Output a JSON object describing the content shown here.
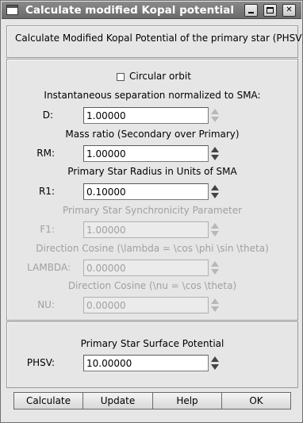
{
  "window": {
    "title": "Calculate modified Kopal potential"
  },
  "header": {
    "description": "Calculate Modified Kopal Potential of the primary star (PHSV):"
  },
  "circular_orbit": {
    "label": "Circular orbit",
    "checked": false
  },
  "fields": {
    "d": {
      "section": "Instantaneous separation normalized to SMA:",
      "label": "D:",
      "value": "1.00000",
      "enabled": true
    },
    "rm": {
      "section": "Mass ratio (Secondary over Primary)",
      "label": "RM:",
      "value": "1.00000",
      "enabled": true
    },
    "r1": {
      "section": "Primary Star Radius in Units of SMA",
      "label": "R1:",
      "value": "0.10000",
      "enabled": true
    },
    "f1": {
      "section": "Primary Star Synchronicity Parameter",
      "label": "F1:",
      "value": "1.00000",
      "enabled": false
    },
    "lambda": {
      "section": "Direction Cosine (\\lambda = \\cos \\phi \\sin \\theta)",
      "label": "LAMBDA:",
      "value": "0.00000",
      "enabled": false
    },
    "nu": {
      "section": "Direction Cosine (\\nu = \\cos \\theta)",
      "label": "NU:",
      "value": "0.00000",
      "enabled": false
    }
  },
  "result": {
    "section": "Primary Star Surface Potential",
    "label": "PHSV:",
    "value": "10.00000"
  },
  "buttons": {
    "calculate": "Calculate",
    "update": "Update",
    "help": "Help",
    "ok": "OK"
  }
}
